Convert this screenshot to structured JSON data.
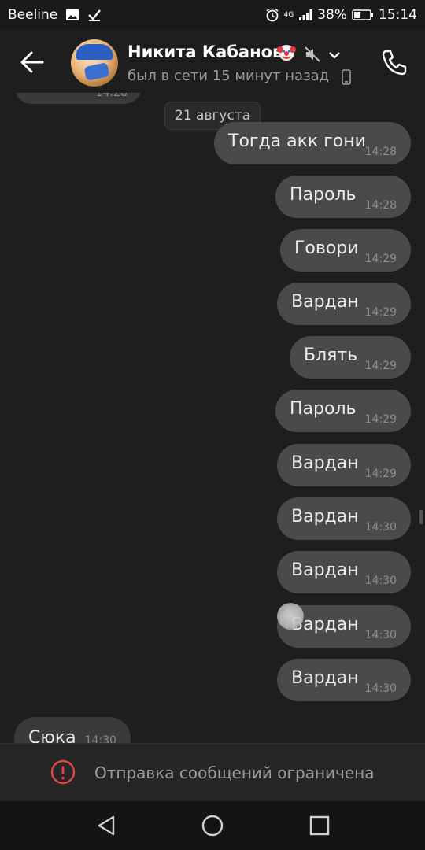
{
  "status_bar": {
    "carrier": "Beeline",
    "network": "4G",
    "battery": "38%",
    "time": "15:14"
  },
  "header": {
    "contact_name": "Никита Кабанов",
    "last_seen": "был в сети 15 минут назад"
  },
  "chat": {
    "top_incoming_time": "14:28",
    "date_separator": "21 августа",
    "outgoing": [
      {
        "text": "Тогда акк гони",
        "time": "14:28"
      },
      {
        "text": "Пароль",
        "time": "14:28"
      },
      {
        "text": "Говори",
        "time": "14:29"
      },
      {
        "text": "Вардан",
        "time": "14:29"
      },
      {
        "text": "Блять",
        "time": "14:29"
      },
      {
        "text": "Пароль",
        "time": "14:29"
      },
      {
        "text": "Вардан",
        "time": "14:29"
      },
      {
        "text": "Вардан",
        "time": "14:30"
      },
      {
        "text": "Вардан",
        "time": "14:30"
      },
      {
        "text": "Вардан",
        "time": "14:30"
      },
      {
        "text": "Вардан",
        "time": "14:30"
      }
    ],
    "incoming_last": {
      "text": "Сюка",
      "time": "14:30"
    }
  },
  "restricted": {
    "text": "Отправка сообщений ограничена"
  },
  "icons": {
    "back": "arrow-left-icon",
    "call": "phone-icon",
    "mute": "muted-speaker-icon",
    "warning": "exclamation-circle-icon"
  },
  "colors": {
    "background": "#1e1e1e",
    "outgoing_bubble": "#4a4a4a",
    "incoming_bubble": "#3a3a3a",
    "warning": "#e0474c"
  }
}
